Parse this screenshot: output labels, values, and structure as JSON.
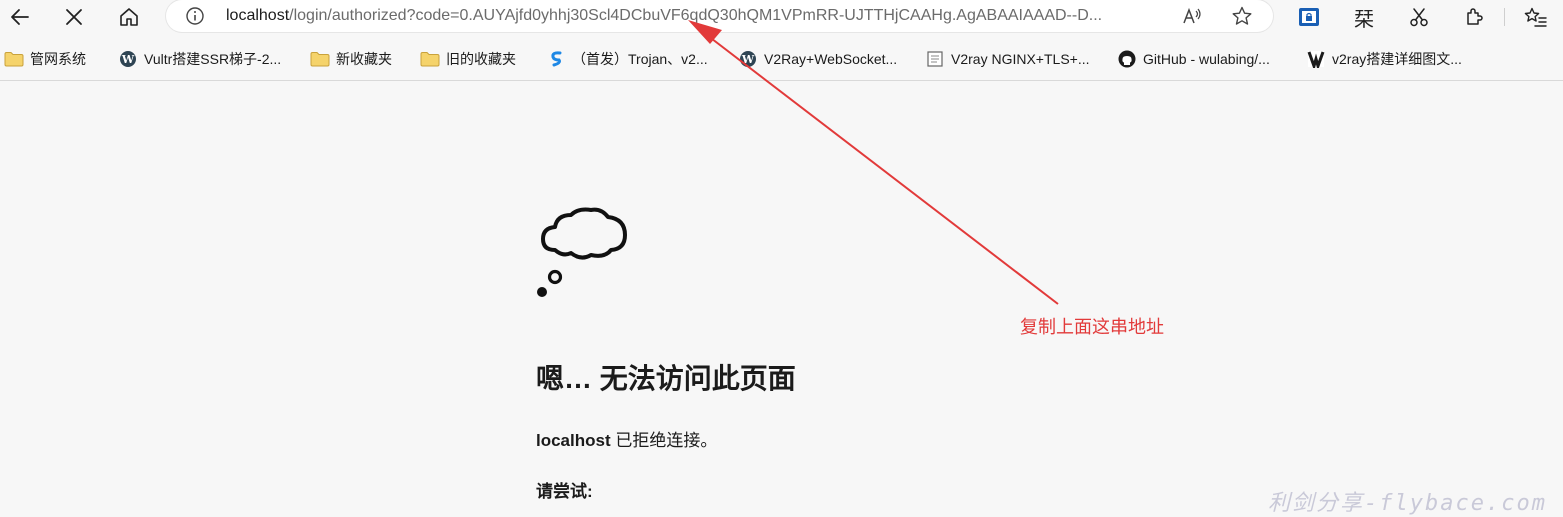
{
  "address_bar": {
    "url_host": "localhost",
    "url_path": "/login/authorized?code=0.AUYAjfd0yhhj30Scl4DCbuVF6qdQ30hQM1VPmRR-UJTTHjCAAHg.AgABAAIAAAD--D..."
  },
  "toolbar": {
    "back_icon": "arrow-left-icon",
    "stop_icon": "close-icon",
    "home_icon": "home-icon",
    "ext_char": "栞"
  },
  "bookmarks": [
    {
      "label": "管网系统",
      "icon": "folder-icon"
    },
    {
      "label": "Vultr搭建SSR梯子-2...",
      "icon": "wordpress-icon"
    },
    {
      "label": "新收藏夹",
      "icon": "folder-icon"
    },
    {
      "label": "旧的收藏夹",
      "icon": "folder-icon"
    },
    {
      "label": "（首发）Trojan、v2...",
      "icon": "s-logo-icon"
    },
    {
      "label": "V2Ray+WebSocket...",
      "icon": "wordpress-icon"
    },
    {
      "label": "V2ray NGINX+TLS+...",
      "icon": "page-icon"
    },
    {
      "label": "GitHub - wulabing/...",
      "icon": "github-icon"
    },
    {
      "label": "v2ray搭建详细图文...",
      "icon": "v2-logo-icon"
    }
  ],
  "error_page": {
    "title": "嗯… 无法访问此页面",
    "host": "localhost",
    "detail": " 已拒绝连接。",
    "try_label": "请尝试:"
  },
  "annotation": {
    "text": "复制上面这串地址",
    "color": "#e23a3a"
  },
  "watermark": "利剑分享-flybace.com"
}
